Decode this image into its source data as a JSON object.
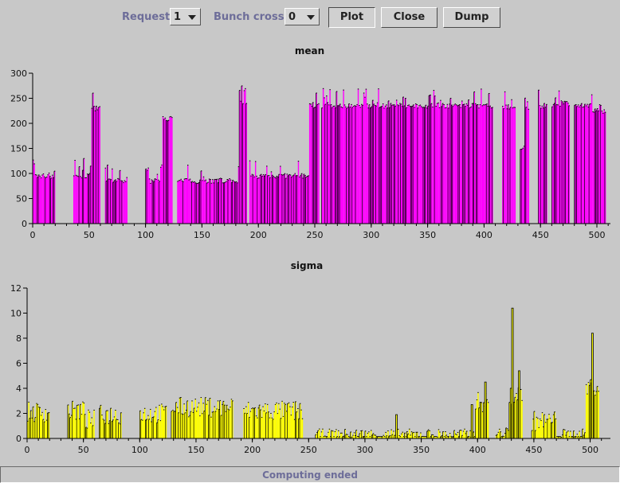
{
  "toolbar": {
    "request_label": "Request",
    "request_value": "1",
    "bunch_cross_label": "Bunch cross",
    "bunch_cross_value": "0",
    "plot_label": "Plot",
    "close_label": "Close",
    "dump_label": "Dump"
  },
  "status": {
    "text": "Computing ended"
  },
  "colors": {
    "mean_fill": "#ff00ff",
    "sigma_fill": "#ffff00",
    "background": "#c8c8c8",
    "outline": "#000000"
  },
  "chart_data": [
    {
      "type": "area",
      "title": "mean",
      "xlim": [
        0,
        512
      ],
      "ylim": [
        0,
        300
      ],
      "xticks": [
        0,
        50,
        100,
        150,
        200,
        250,
        300,
        350,
        400,
        450,
        500
      ],
      "yticks": [
        0,
        50,
        100,
        150,
        200,
        250,
        300
      ],
      "segments": [
        {
          "x": [
            0,
            20
          ],
          "y": 95
        },
        {
          "x": [
            36,
            52
          ],
          "y": 95
        },
        {
          "x": [
            52,
            60
          ],
          "y": 230
        },
        {
          "x": [
            64,
            84
          ],
          "y": 85
        },
        {
          "x": [
            100,
            115
          ],
          "y": 85
        },
        {
          "x": [
            115,
            124
          ],
          "y": 210
        },
        {
          "x": [
            128,
            183
          ],
          "y": 85
        },
        {
          "x": [
            183,
            190
          ],
          "y": 240
        },
        {
          "x": [
            192,
            245
          ],
          "y": 95
        },
        {
          "x": [
            245,
            254
          ],
          "y": 235
        },
        {
          "x": [
            256,
            408
          ],
          "y": 235
        },
        {
          "x": [
            416,
            428
          ],
          "y": 232
        },
        {
          "x": [
            432,
            436
          ],
          "y": 150
        },
        {
          "x": [
            436,
            440
          ],
          "y": 232
        },
        {
          "x": [
            448,
            456
          ],
          "y": 235
        },
        {
          "x": [
            460,
            468
          ],
          "y": 236
        },
        {
          "x": [
            468,
            476
          ],
          "y": 240
        },
        {
          "x": [
            480,
            496
          ],
          "y": 236
        },
        {
          "x": [
            496,
            508
          ],
          "y": 225
        }
      ]
    },
    {
      "type": "area",
      "title": "sigma",
      "xlim": [
        0,
        518
      ],
      "ylim": [
        0,
        12
      ],
      "xticks": [
        0,
        50,
        100,
        150,
        200,
        250,
        300,
        350,
        400,
        450,
        500
      ],
      "yticks": [
        0,
        2,
        4,
        6,
        8,
        10,
        12
      ],
      "segments": [
        {
          "x": [
            0,
            20
          ],
          "y": 1.8
        },
        {
          "x": [
            36,
            52
          ],
          "y": 1.9
        },
        {
          "x": [
            52,
            60
          ],
          "y": 1.2
        },
        {
          "x": [
            64,
            84
          ],
          "y": 1.6
        },
        {
          "x": [
            100,
            124
          ],
          "y": 1.7
        },
        {
          "x": [
            128,
            183
          ],
          "y": 2.2
        },
        {
          "x": [
            192,
            245
          ],
          "y": 1.9
        },
        {
          "x": [
            256,
            398
          ],
          "y": 0.3
        },
        {
          "x": [
            398,
            410
          ],
          "y": 2.6
        },
        {
          "x": [
            416,
            428
          ],
          "y": 0.4
        },
        {
          "x": [
            428,
            440
          ],
          "y": 3.2
        },
        {
          "x": [
            448,
            470
          ],
          "y": 1.1
        },
        {
          "x": [
            470,
            496
          ],
          "y": 0.3
        },
        {
          "x": [
            496,
            508
          ],
          "y": 3.8
        }
      ],
      "spikes": [
        {
          "x": 431,
          "y": 10.4
        },
        {
          "x": 407,
          "y": 4.5
        },
        {
          "x": 437,
          "y": 5.4
        },
        {
          "x": 502,
          "y": 8.4
        },
        {
          "x": 395,
          "y": 2.7
        },
        {
          "x": 328,
          "y": 1.9
        }
      ]
    }
  ]
}
